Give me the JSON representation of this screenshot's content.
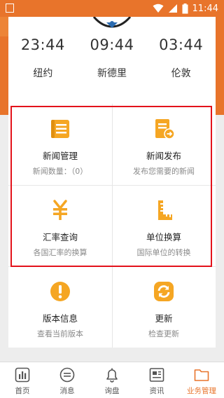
{
  "status_bar": {
    "time": "11:44"
  },
  "clocks": [
    {
      "time": "23:44",
      "city": "纽约"
    },
    {
      "time": "09:44",
      "city": "新德里"
    },
    {
      "time": "03:44",
      "city": "伦敦"
    }
  ],
  "tiles": [
    {
      "title": "新闻管理",
      "subtitle": "新闻数量：（0）",
      "icon": "news-list-icon"
    },
    {
      "title": "新闻发布",
      "subtitle": "发布您需要的新闻",
      "icon": "news-publish-icon"
    },
    {
      "title": "汇率查询",
      "subtitle": "各国汇率的换算",
      "icon": "yen-icon"
    },
    {
      "title": "单位换算",
      "subtitle": "国际单位的转换",
      "icon": "ruler-icon"
    },
    {
      "title": "版本信息",
      "subtitle": "查看当前版本",
      "icon": "info-icon"
    },
    {
      "title": "更新",
      "subtitle": "检查更新",
      "icon": "refresh-icon"
    }
  ],
  "bottom_nav": [
    {
      "label": "首页",
      "icon": "chart-icon"
    },
    {
      "label": "消息",
      "icon": "chat-icon"
    },
    {
      "label": "询盘",
      "icon": "bell-icon"
    },
    {
      "label": "资讯",
      "icon": "newspaper-icon"
    },
    {
      "label": "业务管理",
      "icon": "folder-icon",
      "active": true
    }
  ],
  "colors": {
    "accent": "#e8742b",
    "tile_icon": "#f5a623",
    "highlight_box": "#e3121b"
  }
}
